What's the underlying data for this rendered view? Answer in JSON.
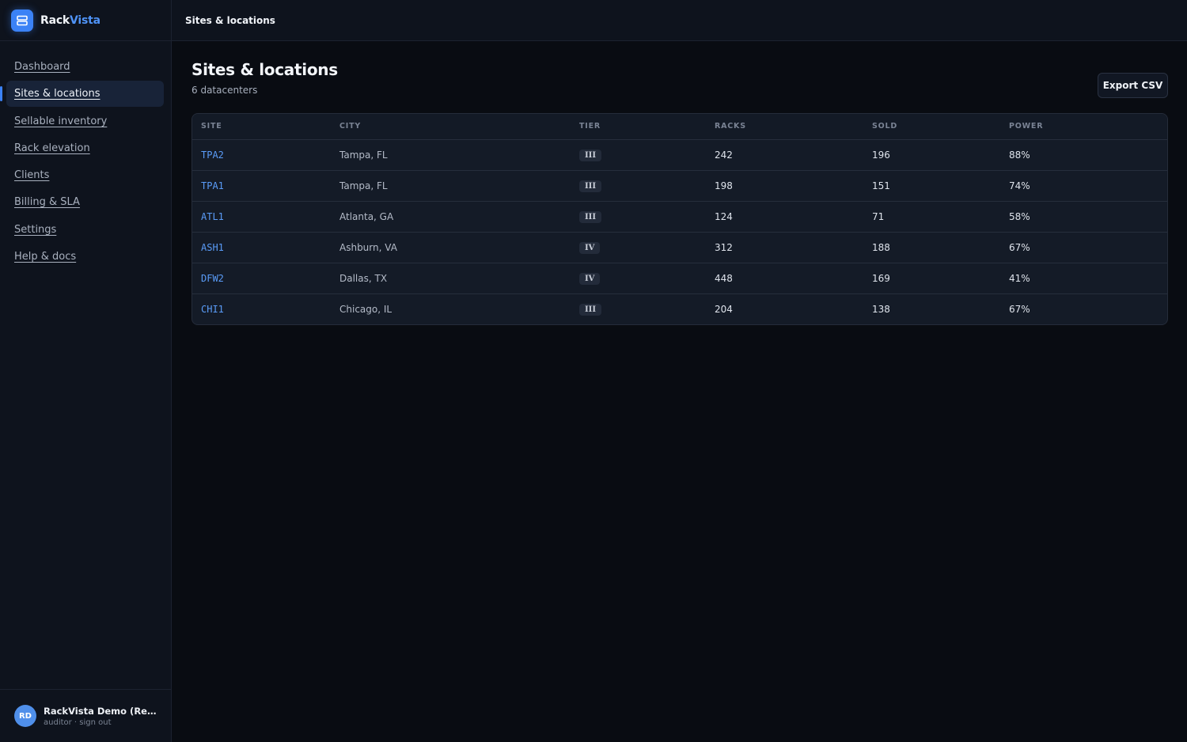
{
  "brand": {
    "name_part1": "Rack",
    "name_part2": "Vista"
  },
  "sidebar": {
    "items": [
      {
        "label": "Dashboard",
        "active": false
      },
      {
        "label": "Sites & locations",
        "active": true
      },
      {
        "label": "Sellable inventory",
        "active": false
      },
      {
        "label": "Rack elevation",
        "active": false
      },
      {
        "label": "Clients",
        "active": false
      },
      {
        "label": "Billing & SLA",
        "active": false
      },
      {
        "label": "Settings",
        "active": false
      },
      {
        "label": "Help & docs",
        "active": false
      }
    ]
  },
  "user": {
    "initials": "RD",
    "name": "RackVista Demo (Read-only)",
    "sub": "auditor · sign out"
  },
  "topbar": {
    "title": "Sites & locations"
  },
  "page": {
    "title": "Sites & locations",
    "subtitle": "6 datacenters",
    "export_label": "Export CSV"
  },
  "table": {
    "columns": [
      "SITE",
      "CITY",
      "TIER",
      "RACKS",
      "SOLD",
      "POWER"
    ],
    "rows": [
      {
        "site": "TPA2",
        "city": "Tampa, FL",
        "tier": "III",
        "racks": "242",
        "sold": "196",
        "power": "88%"
      },
      {
        "site": "TPA1",
        "city": "Tampa, FL",
        "tier": "III",
        "racks": "198",
        "sold": "151",
        "power": "74%"
      },
      {
        "site": "ATL1",
        "city": "Atlanta, GA",
        "tier": "III",
        "racks": "124",
        "sold": "71",
        "power": "58%"
      },
      {
        "site": "ASH1",
        "city": "Ashburn, VA",
        "tier": "IV",
        "racks": "312",
        "sold": "188",
        "power": "67%"
      },
      {
        "site": "DFW2",
        "city": "Dallas, TX",
        "tier": "IV",
        "racks": "448",
        "sold": "169",
        "power": "41%"
      },
      {
        "site": "CHI1",
        "city": "Chicago, IL",
        "tier": "III",
        "racks": "204",
        "sold": "138",
        "power": "67%"
      }
    ]
  },
  "colors": {
    "accent": "#3b82f6",
    "link": "#5a9cf8",
    "background": "#090c12",
    "sidebar": "#0e131d"
  }
}
